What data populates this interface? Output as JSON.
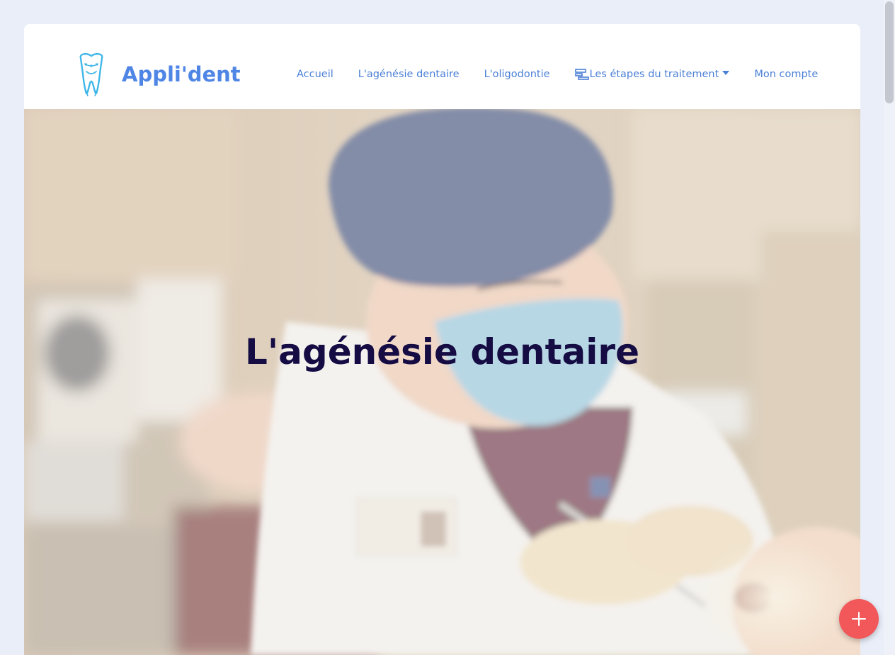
{
  "brand": {
    "name": "Appli'dent",
    "logo_icon": "tooth-braces-icon"
  },
  "nav": {
    "items": [
      {
        "label": "Accueil"
      },
      {
        "label": "L'agénésie dentaire"
      },
      {
        "label": "L'oligodontie"
      },
      {
        "label": "Les étapes du traitement",
        "icon": "steps-list-icon",
        "dropdown": true
      },
      {
        "label": "Mon compte"
      }
    ]
  },
  "hero": {
    "title": "L'agénésie dentaire",
    "image": "dentist-treating-patient-photo"
  },
  "fab": {
    "icon": "plus-icon"
  },
  "colors": {
    "brand": "#4f86e6",
    "nav_link": "#4a7fd6",
    "hero_title": "#150c44",
    "fab": "#f2575a",
    "page_bg": "#e9eef9"
  }
}
